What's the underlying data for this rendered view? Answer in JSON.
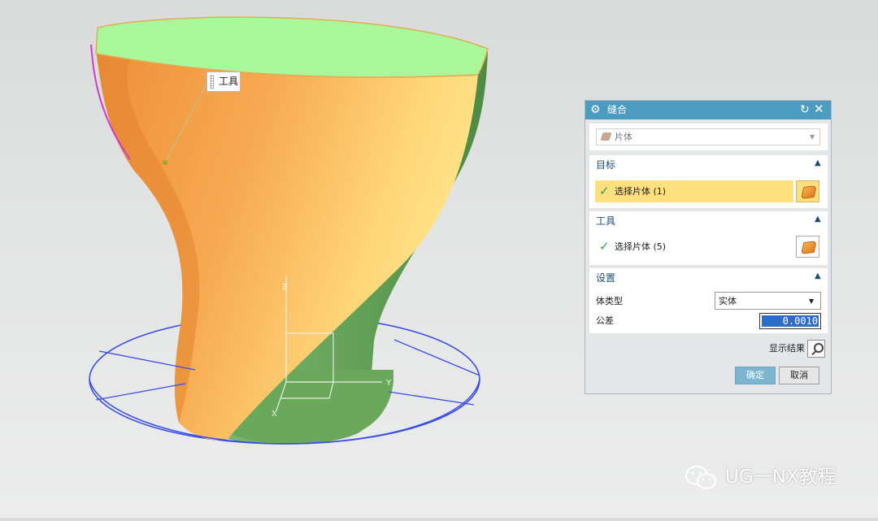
{
  "viewport": {
    "tool_tag": "工具",
    "axis_labels": {
      "x": "X",
      "y": "Y",
      "z": "Z"
    }
  },
  "dialog": {
    "title": "缝合",
    "type": {
      "value": "片体"
    },
    "target": {
      "header": "目标",
      "select_label": "选择片体 (1)"
    },
    "tool": {
      "header": "工具",
      "select_label": "选择片体 (5)"
    },
    "settings": {
      "header": "设置",
      "body_type_label": "体类型",
      "body_type_value": "实体",
      "tolerance_label": "公差",
      "tolerance_value": "0.0010"
    },
    "preview_label": "显示结果",
    "ok_label": "确定",
    "cancel_label": "取消"
  },
  "watermark": {
    "text": "UG一NX教程"
  },
  "colors": {
    "title_bar": "#4c9cc0",
    "active_selection": "#ffdf7e",
    "model_orange": "#f5a24a",
    "model_green": "#6aa85c",
    "model_top": "#a9f69b",
    "csys_blue": "#3b4ee6"
  }
}
